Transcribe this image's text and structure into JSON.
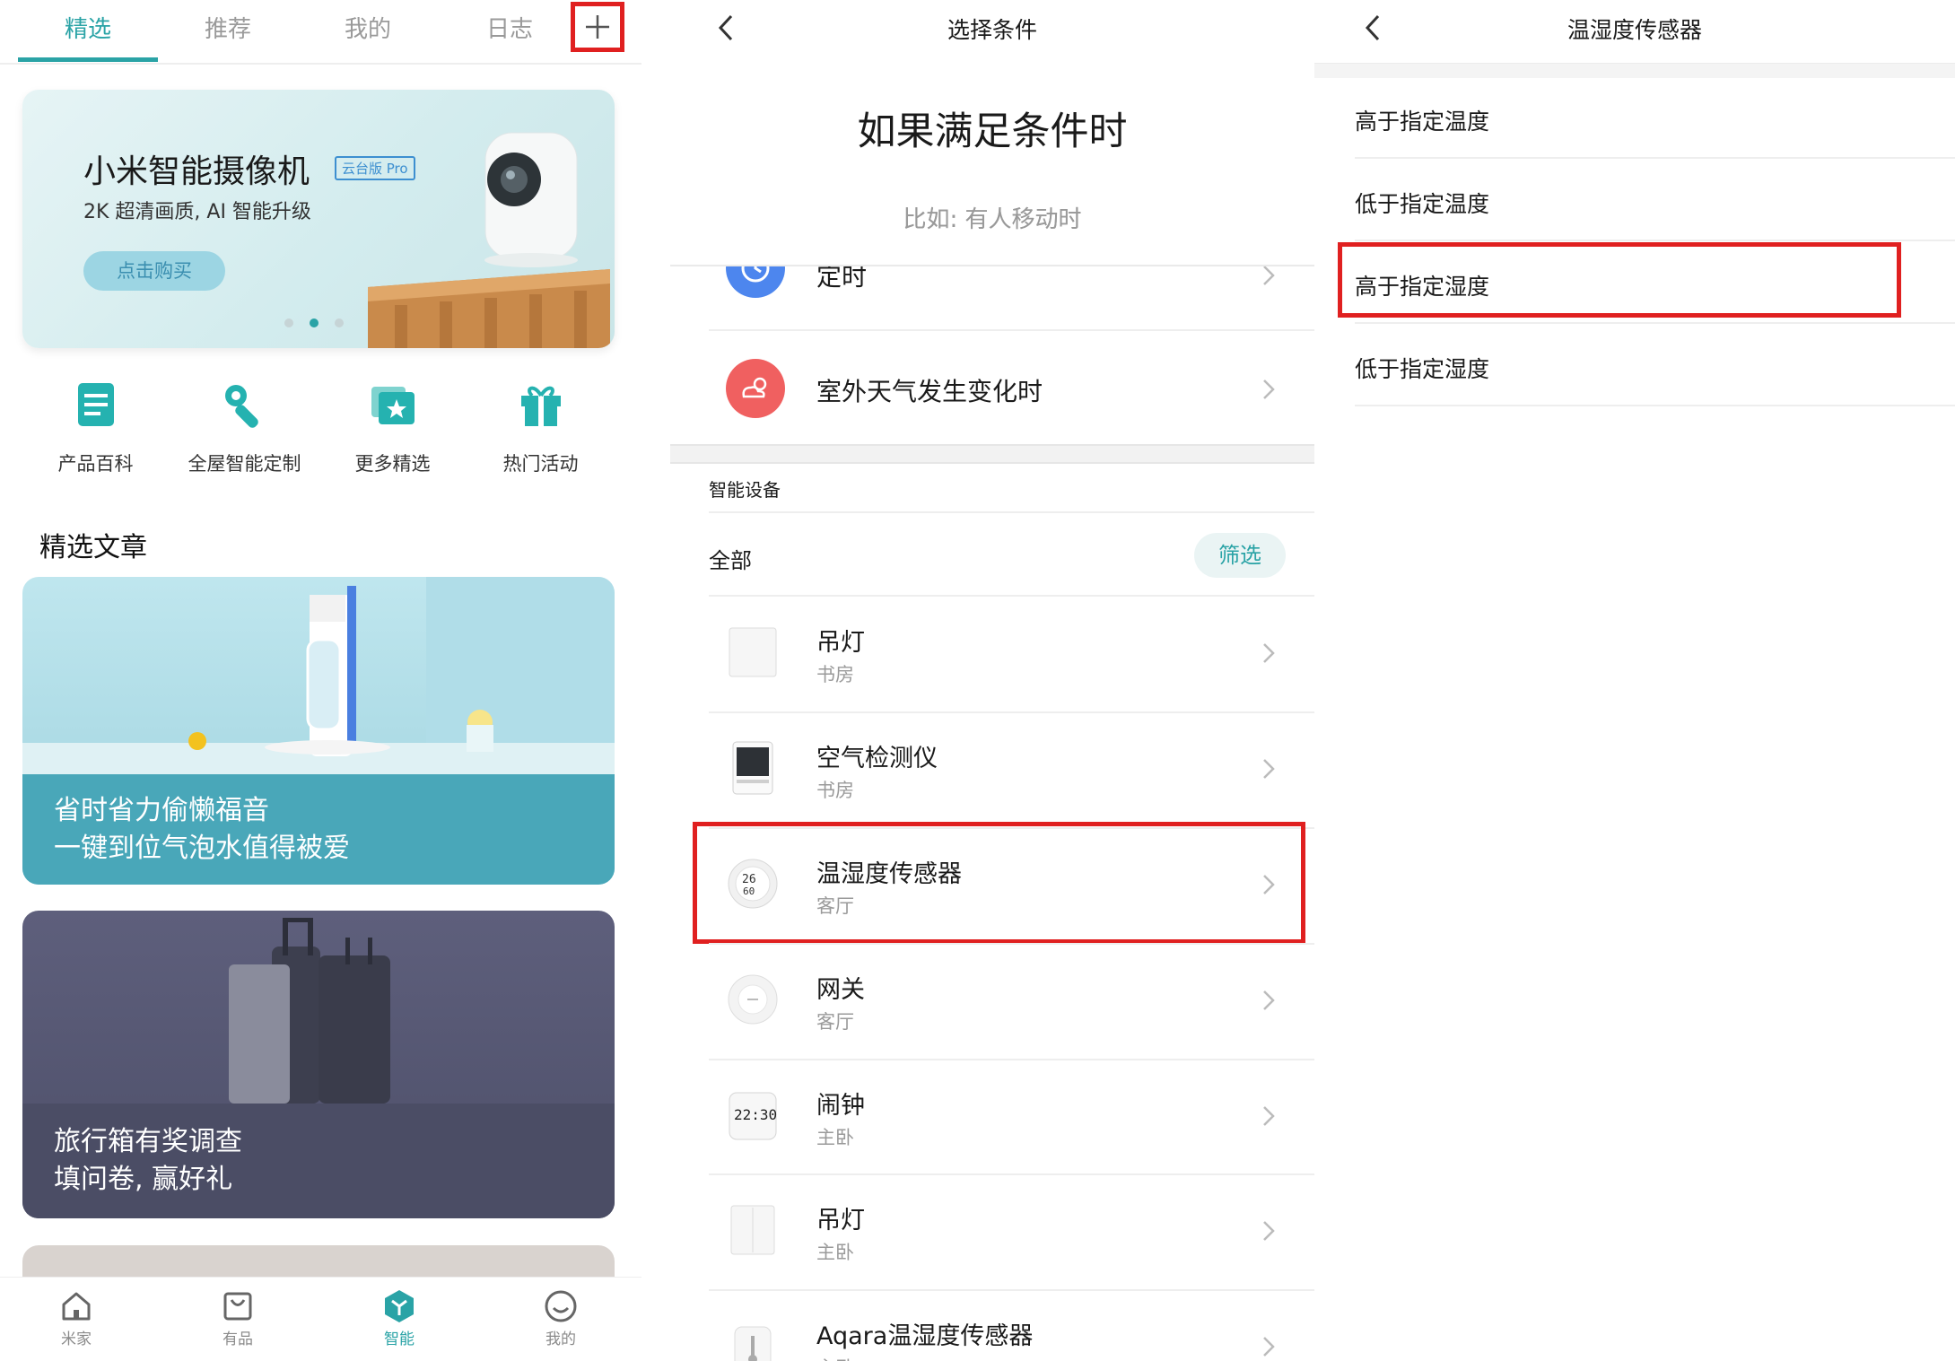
{
  "panel1": {
    "tabs": [
      "精选",
      "推荐",
      "我的",
      "日志"
    ],
    "active_tab": "精选",
    "banner": {
      "title": "小米智能摄像机",
      "tag": "云台版 Pro",
      "subtitle": "2K 超清画质, AI 智能升级",
      "button": "点击购买"
    },
    "quick_links": [
      "产品百科",
      "全屋智能定制",
      "更多精选",
      "热门活动"
    ],
    "section_title": "精选文章",
    "articles": [
      {
        "line1": "省时省力偷懒福音",
        "line2": "一键到位气泡水值得被爱"
      },
      {
        "line1": "旅行箱有奖调查",
        "line2": "填问卷, 赢好礼"
      }
    ],
    "bottom_nav": [
      "米家",
      "有品",
      "智能",
      "我的"
    ],
    "active_nav": "智能"
  },
  "panel2": {
    "header_title": "选择条件",
    "title": "如果满足条件时",
    "hint": "比如: 有人移动时",
    "triggers": [
      "定时",
      "室外天气发生变化时"
    ],
    "section_label": "智能设备",
    "all_label": "全部",
    "filter_button": "筛选",
    "devices": [
      {
        "name": "吊灯",
        "room": "书房"
      },
      {
        "name": "空气检测仪",
        "room": "书房"
      },
      {
        "name": "温湿度传感器",
        "room": "客厅"
      },
      {
        "name": "网关",
        "room": "客厅"
      },
      {
        "name": "闹钟",
        "room": "主卧"
      },
      {
        "name": "吊灯",
        "room": "主卧"
      },
      {
        "name": "Aqara温湿度传感器",
        "room": "主卧"
      }
    ],
    "device_icon_text": {
      "sensor_line1": "26",
      "sensor_line2": "60",
      "clock": "22:30"
    }
  },
  "panel3": {
    "header_title": "温湿度传感器",
    "options": [
      "高于指定温度",
      "低于指定温度",
      "高于指定湿度",
      "低于指定湿度"
    ]
  },
  "colors": {
    "accent": "#2aa3a6",
    "highlight": "#e02020"
  }
}
